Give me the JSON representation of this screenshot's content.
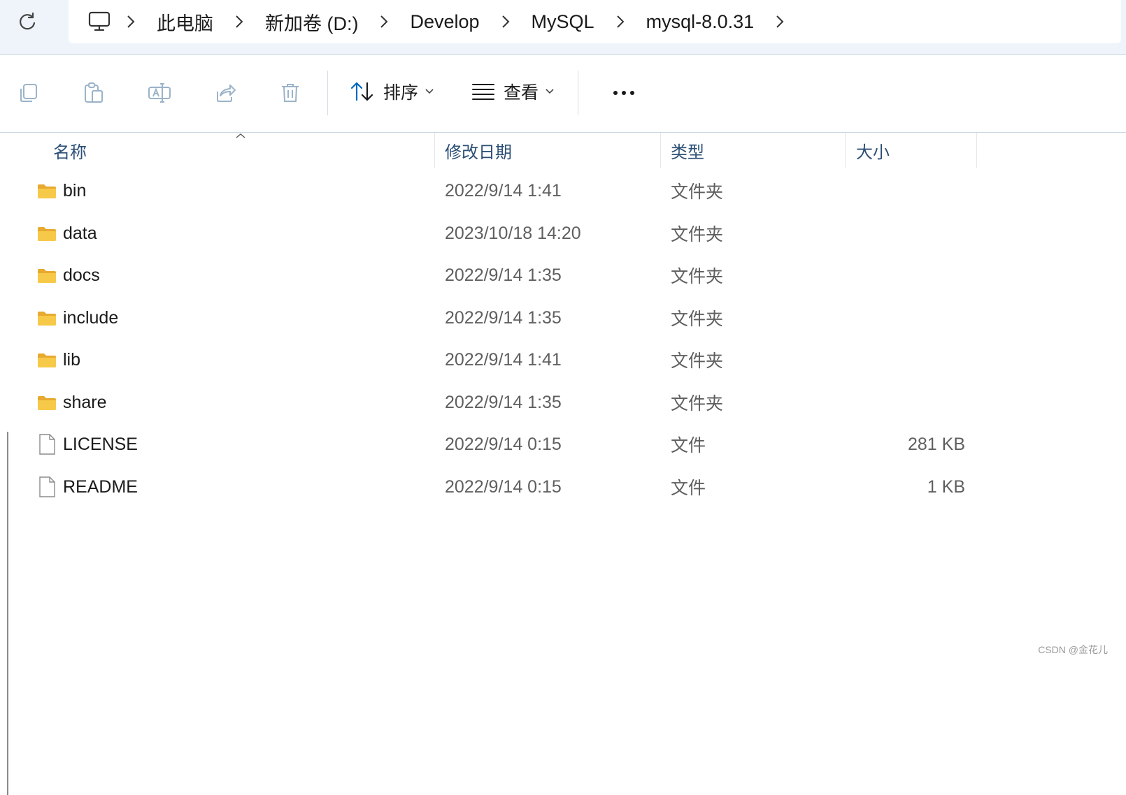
{
  "address_bar": {
    "breadcrumbs": [
      "此电脑",
      "新加卷 (D:)",
      "Develop",
      "MySQL",
      "mysql-8.0.31"
    ]
  },
  "toolbar": {
    "icons": [
      "copy-icon",
      "paste-icon",
      "rename-icon",
      "share-icon",
      "delete-icon"
    ],
    "sort_label": "排序",
    "view_label": "查看"
  },
  "columns": {
    "name": "名称",
    "date": "修改日期",
    "type": "类型",
    "size": "大小"
  },
  "files": [
    {
      "name": "bin",
      "date": "2022/9/14 1:41",
      "type": "文件夹",
      "size": "",
      "icon": "folder-icon"
    },
    {
      "name": "data",
      "date": "2023/10/18 14:20",
      "type": "文件夹",
      "size": "",
      "icon": "folder-icon"
    },
    {
      "name": "docs",
      "date": "2022/9/14 1:35",
      "type": "文件夹",
      "size": "",
      "icon": "folder-icon"
    },
    {
      "name": "include",
      "date": "2022/9/14 1:35",
      "type": "文件夹",
      "size": "",
      "icon": "folder-icon"
    },
    {
      "name": "lib",
      "date": "2022/9/14 1:41",
      "type": "文件夹",
      "size": "",
      "icon": "folder-icon"
    },
    {
      "name": "share",
      "date": "2022/9/14 1:35",
      "type": "文件夹",
      "size": "",
      "icon": "folder-icon"
    },
    {
      "name": "LICENSE",
      "date": "2022/9/14 0:15",
      "type": "文件",
      "size": "281 KB",
      "icon": "file-icon"
    },
    {
      "name": "README",
      "date": "2022/9/14 0:15",
      "type": "文件",
      "size": "1 KB",
      "icon": "file-icon"
    }
  ],
  "watermark": "CSDN @金花儿",
  "colors": {
    "folder": "#f2c14e",
    "header_text": "#2b4f75",
    "accent": "#0067c0"
  }
}
